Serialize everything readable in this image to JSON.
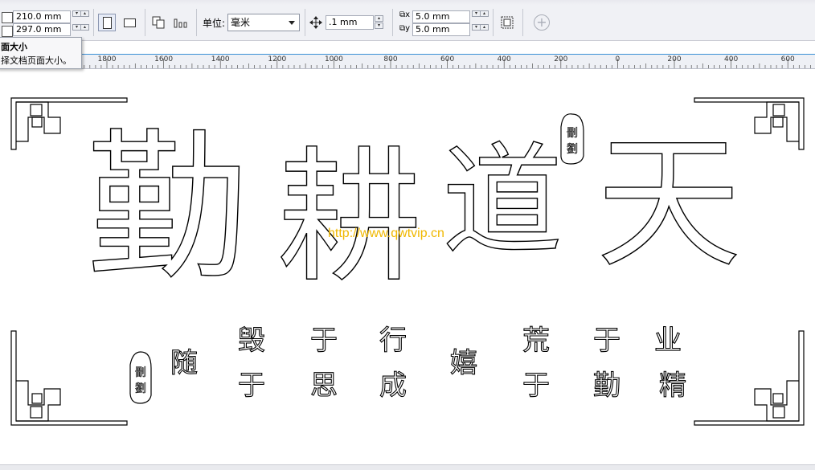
{
  "property_bar": {
    "page_width": "210.0 mm",
    "page_height": "297.0 mm",
    "units_label": "单位:",
    "units_value": "毫米",
    "nudge_value": ".1 mm",
    "dup_x": "5.0 mm",
    "dup_y": "5.0 mm"
  },
  "tooltip": {
    "title": "面大小",
    "description": "择文档页面大小。"
  },
  "ruler": {
    "labels": [
      "1800",
      "1600",
      "1400",
      "1200",
      "1000",
      "800",
      "600",
      "400",
      "200",
      "0",
      "200",
      "400",
      "600"
    ]
  },
  "artwork": {
    "title_chars": [
      "勤",
      "耕",
      "道",
      "天"
    ],
    "motto_chars": [
      "随",
      "毁",
      "于",
      "于",
      "思",
      "行",
      "成",
      "嬉",
      "荒",
      "于",
      "于",
      "勤",
      "业",
      "精"
    ],
    "watermark": "http://www.qwtvip.cn"
  },
  "icons": {
    "portrait": "portrait-page-icon",
    "landscape": "landscape-page-icon",
    "nudge": "nudge-move-icon",
    "add": "add-page-icon"
  }
}
